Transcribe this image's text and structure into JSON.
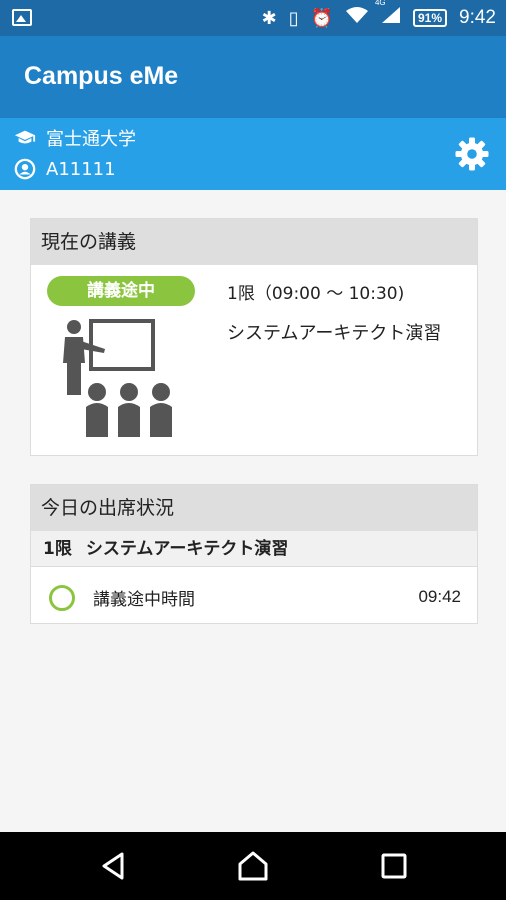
{
  "status_bar": {
    "time": "9:42",
    "battery": "91%",
    "network": "4G",
    "icons": [
      "image-icon",
      "bluetooth-icon",
      "vibrate-icon",
      "alarm-icon",
      "wifi-icon",
      "signal-icon",
      "battery-icon"
    ]
  },
  "app_bar": {
    "title": "Campus eMe"
  },
  "user": {
    "university": "富士通大学",
    "student_id": "A11111",
    "icons": [
      "graduation-cap-icon",
      "user-icon",
      "gear-icon"
    ]
  },
  "current_lecture": {
    "header": "現在の講義",
    "badge": "講義途中",
    "period": "1限（09:00 〜 10:30)",
    "course": "システムアーキテクト演習",
    "illustration": "lecture-illustration-icon"
  },
  "attendance": {
    "header": "今日の出席状況",
    "period_label": "1限",
    "course": "システムアーキテクト演習",
    "rows": [
      {
        "status": "講義途中時間",
        "time": "09:42",
        "icon": "circle-icon"
      }
    ]
  },
  "nav_bar": {
    "icons": [
      "back-icon",
      "home-icon",
      "recents-icon"
    ]
  },
  "colors": {
    "status_bar": "#1d6aa6",
    "app_bar": "#2080c6",
    "user_bar": "#28a0e8",
    "badge": "#8bc53f"
  }
}
